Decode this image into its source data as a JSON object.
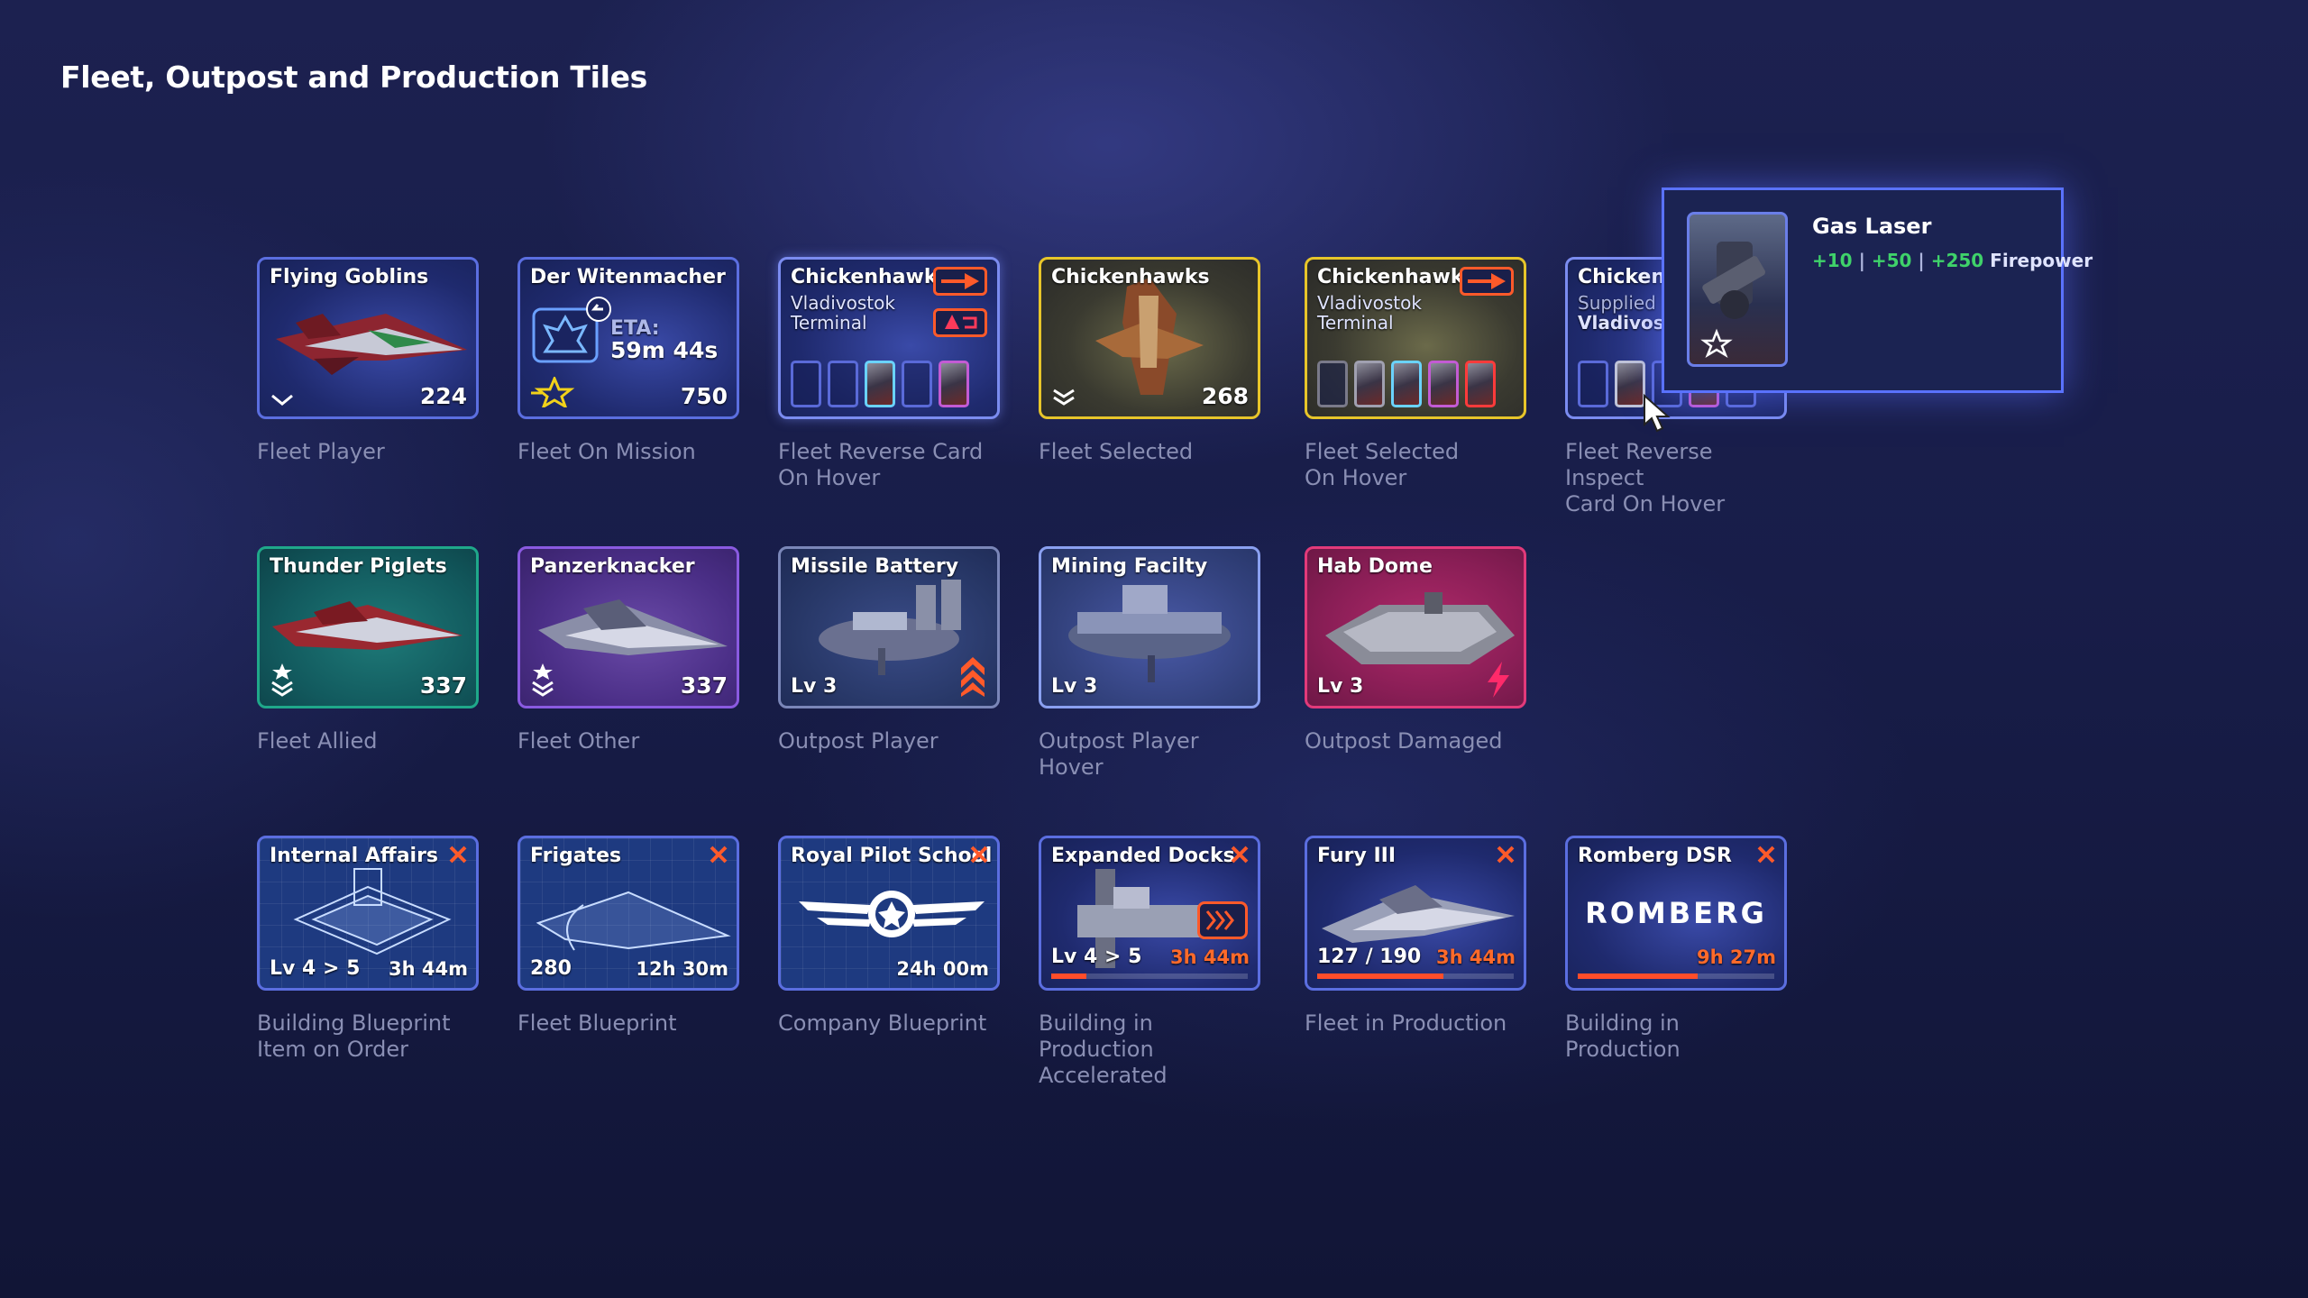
{
  "title": "Fleet, Outpost and Production Tiles",
  "row1": [
    {
      "name": "Flying Goblins",
      "value": "224",
      "caption": "Fleet Player"
    },
    {
      "name": "Der Witenmacher",
      "eta_label": "ETA:",
      "eta": "59m 44s",
      "value": "750",
      "caption": "Fleet On Mission"
    },
    {
      "name": "Chickenhawks",
      "sub1": "Vladivostok",
      "sub2": "Terminal",
      "caption": "Fleet Reverse Card\nOn Hover"
    },
    {
      "name": "Chickenhawks",
      "value": "268",
      "caption": "Fleet Selected"
    },
    {
      "name": "Chickenhawks",
      "sub1": "Vladivostok",
      "sub2": "Terminal",
      "caption": "Fleet Selected\nOn Hover"
    },
    {
      "name": "Chickenha",
      "sub1": "Supplied E",
      "sub2": "Vladivost",
      "caption": "Fleet Reverse Inspect\nCard On Hover"
    }
  ],
  "row2": [
    {
      "name": "Thunder Piglets",
      "value": "337",
      "caption": "Fleet Allied"
    },
    {
      "name": "Panzerknacker",
      "value": "337",
      "caption": "Fleet Other"
    },
    {
      "name": "Missile Battery",
      "level": "Lv 3",
      "caption": "Outpost Player"
    },
    {
      "name": "Mining Facilty",
      "level": "Lv 3",
      "caption": "Outpost Player Hover"
    },
    {
      "name": "Hab Dome",
      "level": "Lv 3",
      "caption": "Outpost Damaged"
    }
  ],
  "row3": [
    {
      "name": "Internal Affairs",
      "level": "Lv 4 > 5",
      "time": "3h 44m",
      "caption": "Building Blueprint\nItem on Order"
    },
    {
      "name": "Frigates",
      "level": "280",
      "time": "12h 30m",
      "caption": "Fleet Blueprint"
    },
    {
      "name": "Royal Pilot School",
      "time": "24h 00m",
      "caption": "Company Blueprint"
    },
    {
      "name": "Expanded Docks",
      "level": "Lv 4 > 5",
      "time": "3h 44m",
      "progress": 0.18,
      "caption": "Building in Production\nAccelerated"
    },
    {
      "name": "Fury III",
      "level": "127 / 190",
      "time": "3h 44m",
      "progress": 0.64,
      "caption": "Fleet in Production"
    },
    {
      "name": "Romberg DSR",
      "logo": "ROMBERG",
      "time": "9h 27m",
      "progress": 0.61,
      "caption": "Building in Production"
    }
  ],
  "popup": {
    "name": "Gas Laser",
    "stat1": "+10",
    "sep": "|",
    "stat2": "+50",
    "stat3": "+250",
    "stat_label": "Firepower"
  },
  "colors": {
    "player_border": "#5b6ee0",
    "selected_border": "#e7c52a",
    "allied_border": "#1fa88a",
    "other_border": "#8a5ae0",
    "damaged_border": "#e23a7a",
    "production_orange": "#ff5a2a",
    "stat_green": "#3fd26a"
  },
  "icons": [
    "chevron-down-icon",
    "star-wings-icon",
    "mission-emblem-icon",
    "arrow-right-icon",
    "return-icon",
    "rank-chevrons-icon",
    "boost-arrows-icon",
    "lightning-icon",
    "close-icon",
    "winged-emblem-icon",
    "accelerate-icon",
    "cursor-icon"
  ]
}
